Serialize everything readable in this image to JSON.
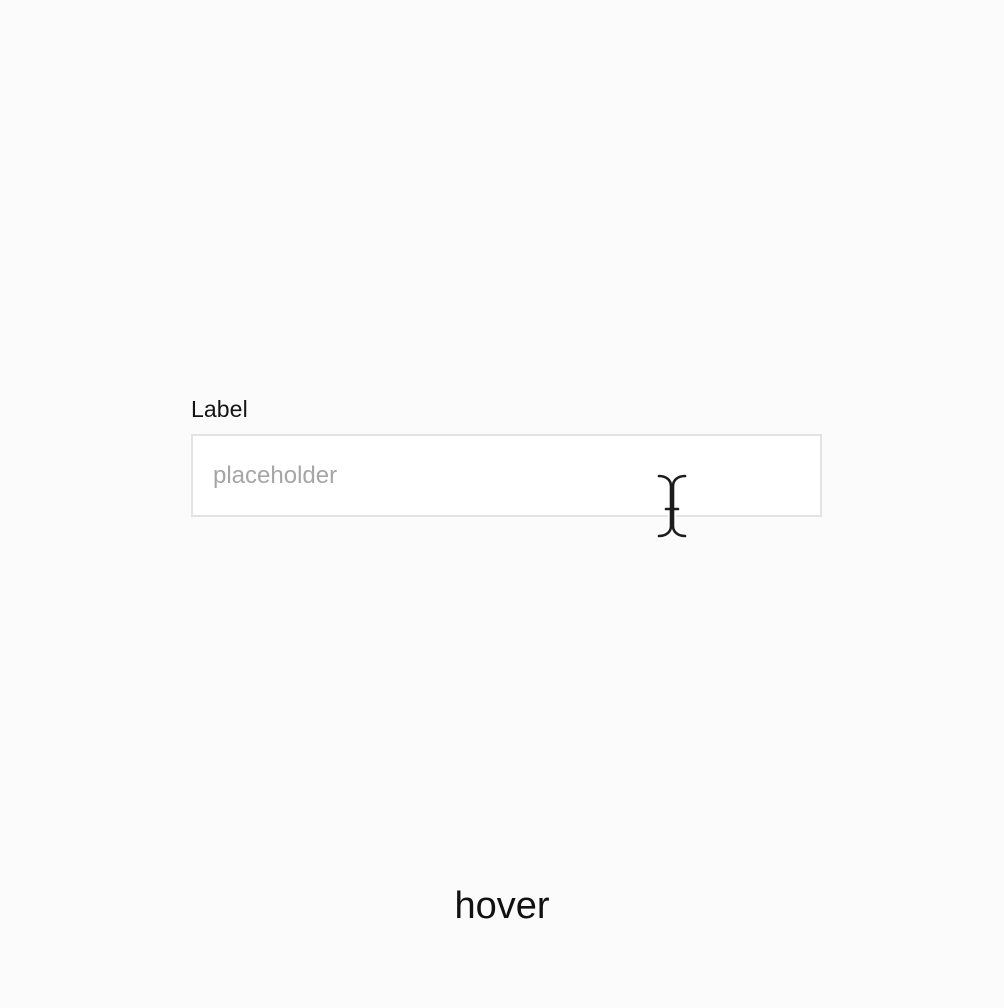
{
  "field": {
    "label": "Label",
    "value": "",
    "placeholder": "placeholder"
  },
  "cursor": {
    "icon": "text-cursor-icon"
  },
  "state_caption": "hover"
}
